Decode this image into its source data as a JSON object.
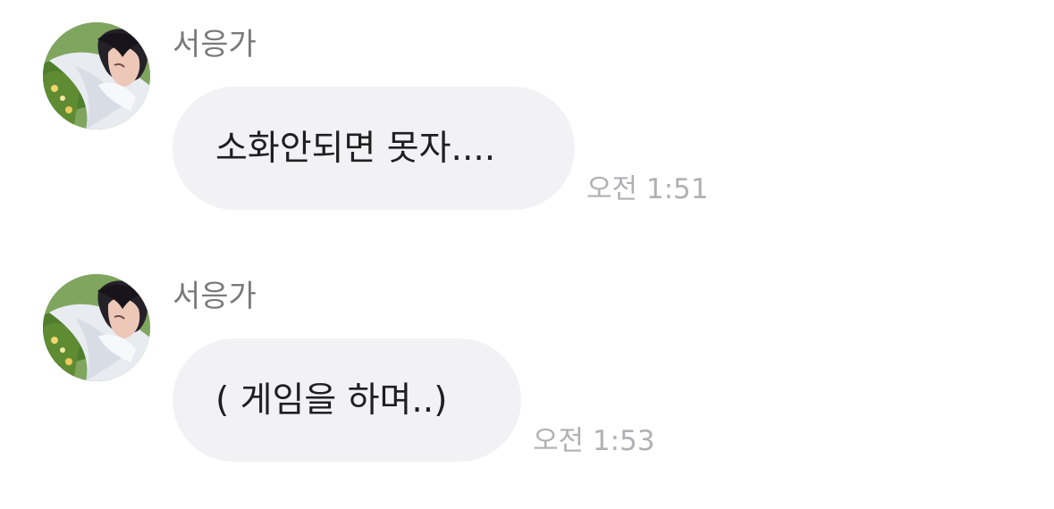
{
  "messages": [
    {
      "sender": "서응가",
      "text": "소화안되면 못자....",
      "time": "오전 1:51",
      "avatar_icon": "profile-photo"
    },
    {
      "sender": "서응가",
      "text": "( 게임을 하며..)",
      "time": "오전 1:53",
      "avatar_icon": "profile-photo"
    }
  ],
  "colors": {
    "background": "#ffffff",
    "bubble": "#f2f2f5",
    "sender_text": "#7a7a7a",
    "message_text": "#1f1f1f",
    "timestamp_text": "#b0b0b5"
  }
}
